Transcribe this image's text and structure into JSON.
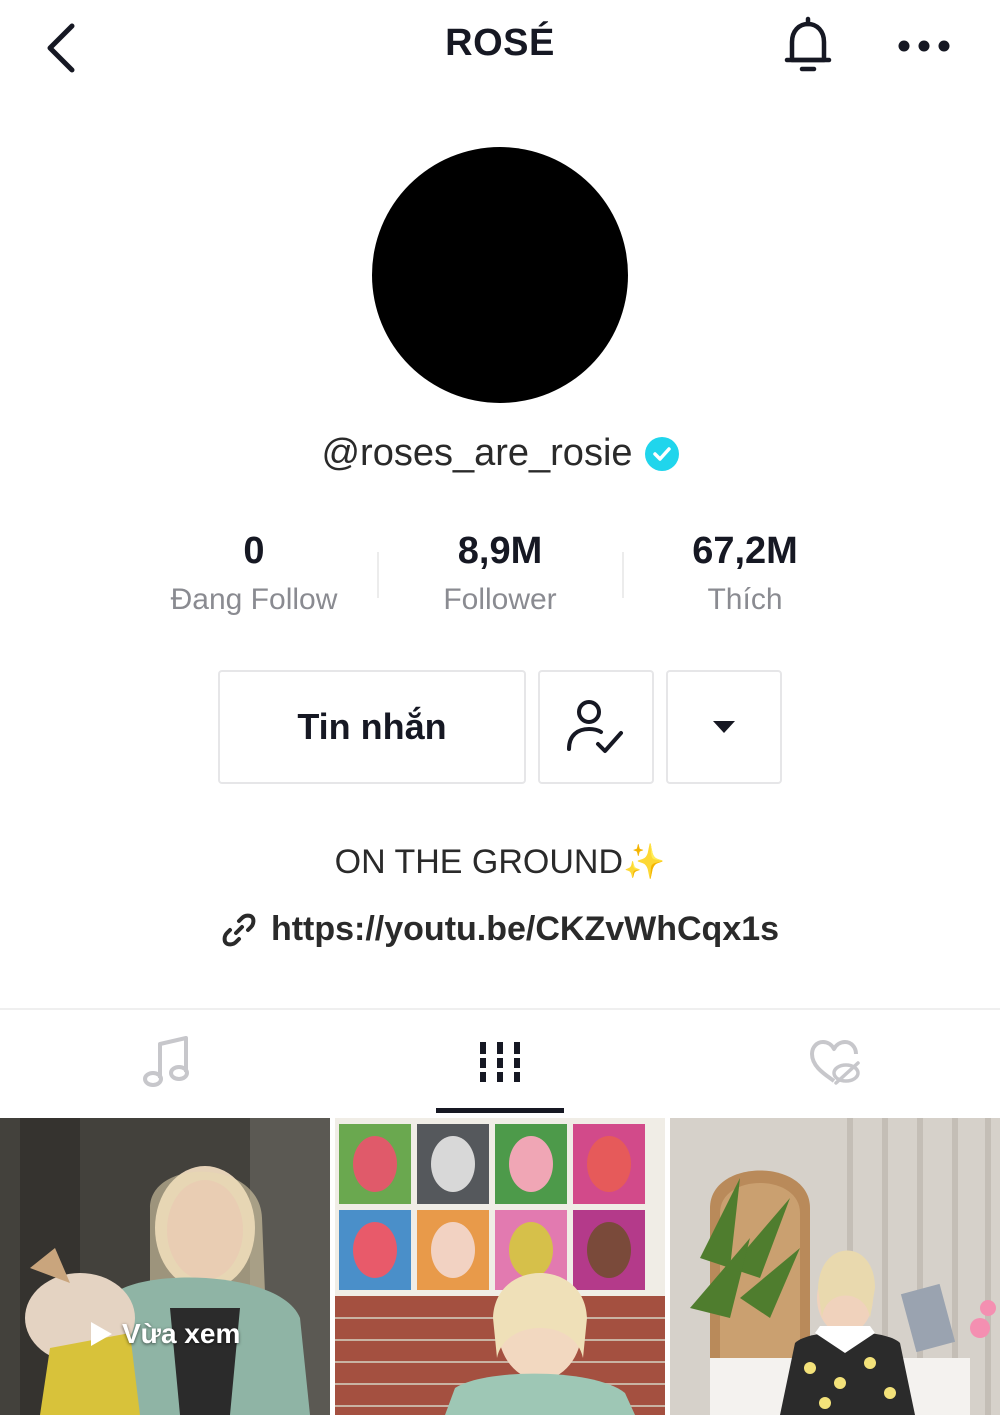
{
  "header": {
    "title": "ROSÉ",
    "back_icon": "chevron-left-icon",
    "bell_icon": "bell-icon",
    "more_icon": "more-horizontal-icon"
  },
  "profile": {
    "username": "@roses_are_rosie",
    "verified_icon": "verified-check-icon",
    "verified_color": "#20d5ec"
  },
  "stats": [
    {
      "value": "0",
      "label": "Đang Follow"
    },
    {
      "value": "8,9M",
      "label": "Follower"
    },
    {
      "value": "67,2M",
      "label": "Thích"
    }
  ],
  "actions": {
    "message_label": "Tin nhắn",
    "follow_icon": "user-check-icon",
    "more_icon": "caret-down-icon"
  },
  "bio": {
    "text": "ON THE GROUND",
    "emoji": "✨",
    "link_icon": "link-icon",
    "link": "https://youtu.be/CKZvWhCqx1s"
  },
  "tabs": [
    {
      "icon": "music-note-icon",
      "active": false
    },
    {
      "icon": "videos-grid-icon",
      "active": true
    },
    {
      "icon": "liked-hidden-icon",
      "active": false
    }
  ],
  "videos": {
    "watched_label": "Vừa xem",
    "watched_icon": "play-icon"
  }
}
